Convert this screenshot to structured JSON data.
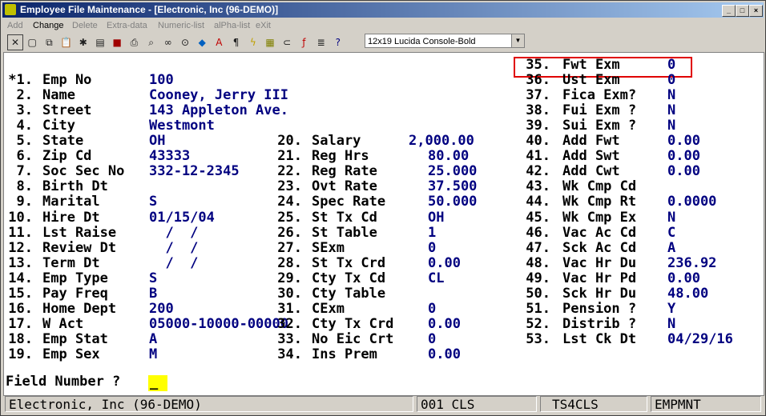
{
  "window": {
    "title": "Employee File Maintenance - [Electronic, Inc (96-DEMO)]",
    "controls": {
      "minimize": "_",
      "maximize": "□",
      "close": "×"
    }
  },
  "menu": [
    {
      "label": "Add",
      "enabled": false
    },
    {
      "label": "Change",
      "enabled": true
    },
    {
      "label": "Delete",
      "enabled": false
    },
    {
      "label": "Extra-data",
      "enabled": false
    },
    {
      "label": "Numeric-list",
      "enabled": false
    },
    {
      "label": "alPha-list",
      "enabled": false
    },
    {
      "label": "eXit",
      "enabled": false
    }
  ],
  "toolbar": {
    "icons": [
      "close-x-icon",
      "select-icon",
      "copy-icon",
      "paste-icon",
      "settings-icon",
      "print-icon",
      "record-icon",
      "printer-icon",
      "search-icon",
      "binoculars-icon",
      "find-icon",
      "color-icon",
      "font-a-icon",
      "text-icon",
      "lightning-icon",
      "calculator-icon",
      "link-icon",
      "function-icon",
      "stack-icon",
      "help-icon"
    ],
    "font_select": "12x19 Lucida Console-Bold"
  },
  "fields": {
    "col1": [
      {
        "num": "*1.",
        "label": "Emp No",
        "value": "100"
      },
      {
        "num": "2.",
        "label": "Name",
        "value": "Cooney, Jerry III"
      },
      {
        "num": "3.",
        "label": "Street",
        "value": "143 Appleton Ave."
      },
      {
        "num": "4.",
        "label": "City",
        "value": "Westmont"
      },
      {
        "num": "5.",
        "label": "State",
        "value": "OH"
      },
      {
        "num": "6.",
        "label": "Zip Cd",
        "value": "43333"
      },
      {
        "num": "7.",
        "label": "Soc Sec No",
        "value": "332-12-2345"
      },
      {
        "num": "8.",
        "label": "Birth Dt",
        "value": ""
      },
      {
        "num": "9.",
        "label": "Marital",
        "value": "S"
      },
      {
        "num": "10.",
        "label": "Hire Dt",
        "value": "01/15/04"
      },
      {
        "num": "11.",
        "label": "Lst Raise",
        "value": "  /  /"
      },
      {
        "num": "12.",
        "label": "Review Dt",
        "value": "  /  /"
      },
      {
        "num": "13.",
        "label": "Term Dt",
        "value": "  /  /"
      },
      {
        "num": "14.",
        "label": "Emp Type",
        "value": "S"
      },
      {
        "num": "15.",
        "label": "Pay Freq",
        "value": "B"
      },
      {
        "num": "16.",
        "label": "Home Dept",
        "value": "200"
      },
      {
        "num": "17.",
        "label": "W Act",
        "value": "05000-10000-00000"
      },
      {
        "num": "18.",
        "label": "Emp Stat",
        "value": "A"
      },
      {
        "num": "19.",
        "label": "Emp Sex",
        "value": "M"
      }
    ],
    "col2": [
      {
        "num": "20.",
        "label": "Salary",
        "value": "2,000.00"
      },
      {
        "num": "21.",
        "label": "Reg Hrs",
        "value": "80.00"
      },
      {
        "num": "22.",
        "label": "Reg Rate",
        "value": "25.000"
      },
      {
        "num": "23.",
        "label": "Ovt Rate",
        "value": "37.500"
      },
      {
        "num": "24.",
        "label": "Spec Rate",
        "value": "50.000"
      },
      {
        "num": "25.",
        "label": "St Tx Cd",
        "value": "OH"
      },
      {
        "num": "26.",
        "label": "St Table",
        "value": "1"
      },
      {
        "num": "27.",
        "label": "SExm",
        "value": "0"
      },
      {
        "num": "28.",
        "label": "St Tx Crd",
        "value": "0.00"
      },
      {
        "num": "29.",
        "label": "Cty Tx Cd",
        "value": "CL"
      },
      {
        "num": "30.",
        "label": "Cty Table",
        "value": ""
      },
      {
        "num": "31.",
        "label": "CExm",
        "value": "0"
      },
      {
        "num": "32.",
        "label": "Cty Tx Crd",
        "value": "0.00"
      },
      {
        "num": "33.",
        "label": "No Eic Crt",
        "value": "0"
      },
      {
        "num": "34.",
        "label": "Ins Prem",
        "value": "0.00"
      }
    ],
    "col3": [
      {
        "num": "35.",
        "label": "Fwt Exm",
        "value": "0"
      },
      {
        "num": "36.",
        "label": "Ust Exm",
        "value": "0"
      },
      {
        "num": "37.",
        "label": "Fica Exm?",
        "value": "N"
      },
      {
        "num": "38.",
        "label": "Fui Exm ?",
        "value": "N"
      },
      {
        "num": "39.",
        "label": "Sui Exm ?",
        "value": "N"
      },
      {
        "num": "40.",
        "label": "Add Fwt",
        "value": "0.00"
      },
      {
        "num": "41.",
        "label": "Add Swt",
        "value": "0.00"
      },
      {
        "num": "42.",
        "label": "Add Cwt",
        "value": "0.00"
      },
      {
        "num": "43.",
        "label": "Wk Cmp Cd",
        "value": ""
      },
      {
        "num": "44.",
        "label": "Wk Cmp Rt",
        "value": "0.0000"
      },
      {
        "num": "45.",
        "label": "Wk Cmp Ex",
        "value": "N"
      },
      {
        "num": "46.",
        "label": "Vac Ac Cd",
        "value": "C"
      },
      {
        "num": "47.",
        "label": "Sck Ac Cd",
        "value": "A"
      },
      {
        "num": "48.",
        "label": "Vac Hr Du",
        "value": "236.92"
      },
      {
        "num": "49.",
        "label": "Vac Hr Pd",
        "value": "0.00"
      },
      {
        "num": "50.",
        "label": "Sck Hr Du",
        "value": "48.00"
      },
      {
        "num": "51.",
        "label": "Pension ?",
        "value": "Y"
      },
      {
        "num": "52.",
        "label": "Distrib ?",
        "value": "N"
      },
      {
        "num": "53.",
        "label": "Lst Ck Dt",
        "value": "04/29/16"
      }
    ]
  },
  "prompt": {
    "label": "Field Number ?",
    "value": "_"
  },
  "status": {
    "company": "Electronic, Inc (96-DEMO)",
    "code": "001 CLS",
    "terminal": "TS4CLS",
    "program": "EMPMNT"
  }
}
